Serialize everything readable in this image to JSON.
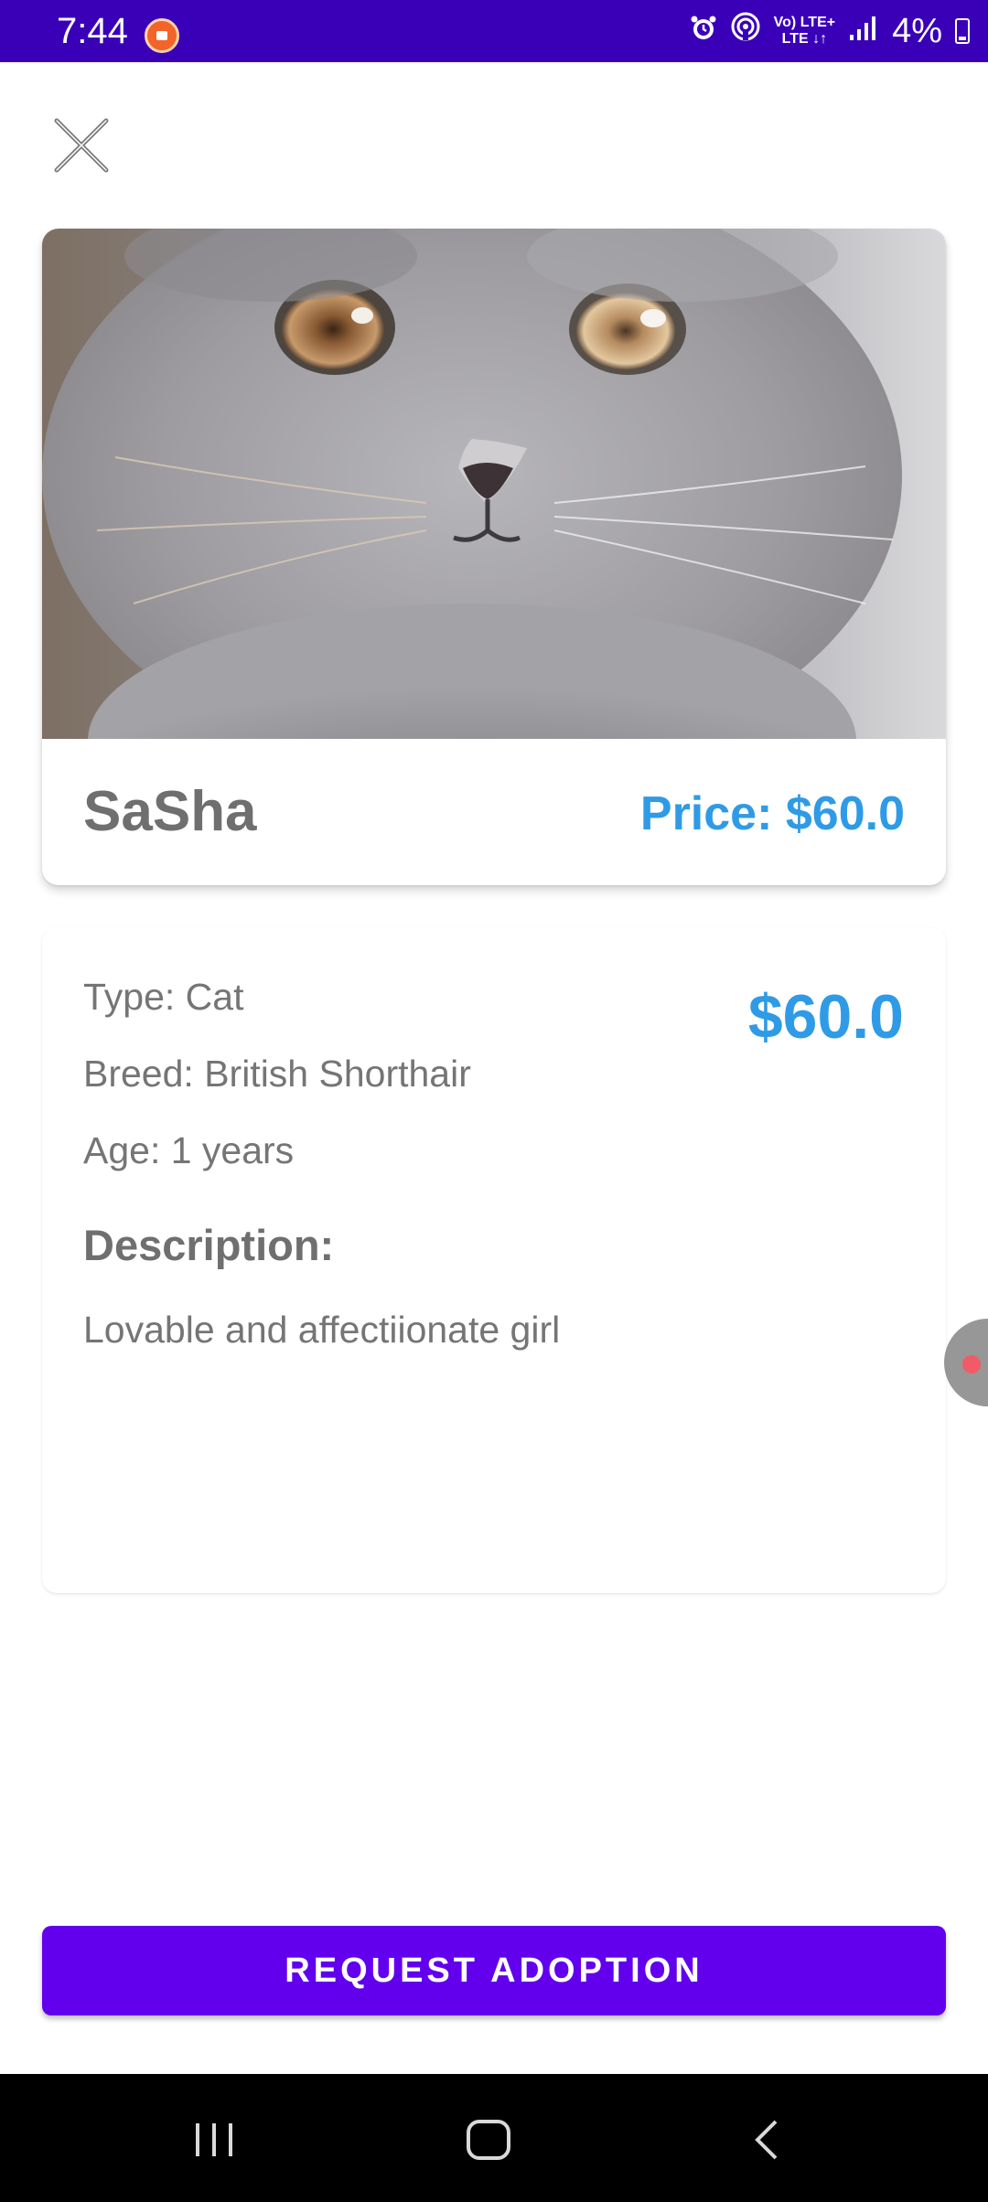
{
  "status_bar": {
    "time": "7:44",
    "battery_text": "4%",
    "network_label_top": "Vo) LTE+",
    "network_label_bottom": "LTE ↓↑",
    "icons": [
      "screen-record-icon",
      "alarm-icon",
      "hotspot-icon",
      "volte-icon",
      "lte-icon",
      "signal-icon",
      "battery-icon"
    ]
  },
  "header": {
    "close_icon": "close-icon"
  },
  "pet": {
    "name": "SaSha",
    "price_label": "Price: $60.0",
    "photo_icon": "cat-photo"
  },
  "details": {
    "type": "Type: Cat",
    "breed": "Breed: British Shorthair",
    "age": "Age: 1 years",
    "price": "$60.0",
    "description_heading": "Description:",
    "description": "Lovable and affectiionate girl"
  },
  "actions": {
    "request_adoption": "REQUEST ADOPTION"
  },
  "colors": {
    "status_bar": "#3a00b8",
    "accent_blue": "#2f9be6",
    "primary_purple": "#6200ee",
    "text_gray": "#757575"
  },
  "nav_bar": {
    "icons": [
      "recents-icon",
      "home-icon",
      "back-icon"
    ]
  }
}
